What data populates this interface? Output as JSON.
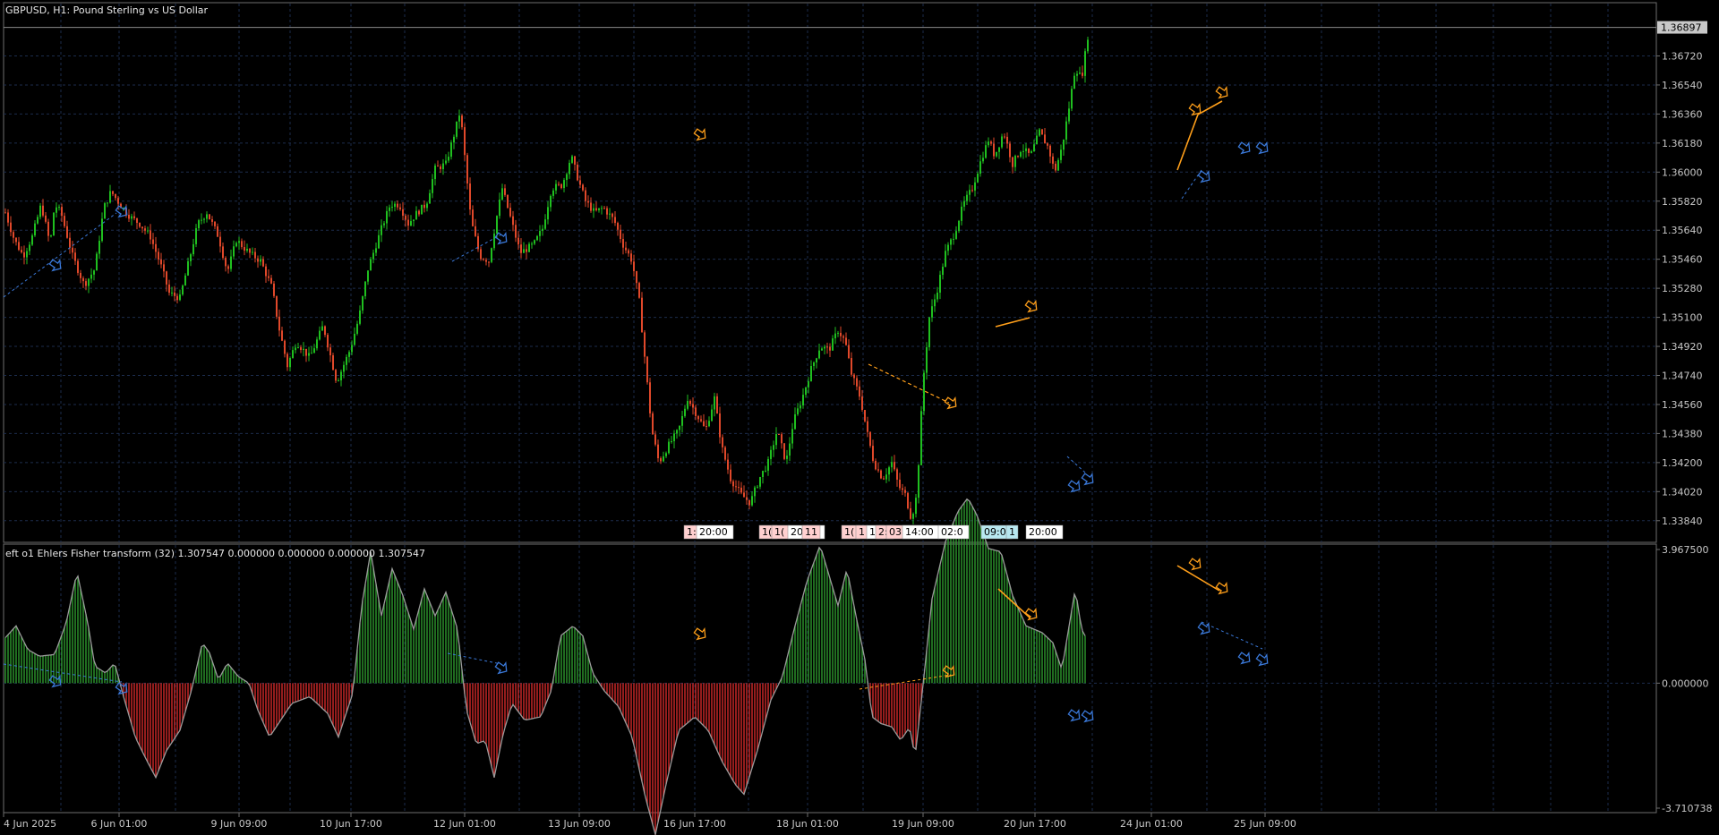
{
  "window": {
    "title": "GBPUSD, H1:  Pound Sterling vs US Dollar"
  },
  "indicator": {
    "title": "eft o1 Ehlers Fisher transform (32) 1.307547 0.000000 0.000000 0.000000 1.307547"
  },
  "colors": {
    "background": "#000000",
    "grid": "#1c2c4c",
    "bull_candle": "#1fbf1f",
    "bear_candle": "#e0482a",
    "histogram_up": "#2e9a2e",
    "histogram_down": "#d42a2a",
    "fisher_line": "#9a9a9a",
    "divergence_bearish": "#ff9f1a",
    "divergence_bullish": "#3a78d8",
    "axis_text": "#c8c8c8"
  },
  "icons": {
    "bearish_signal": "orange-arrow-icon",
    "bullish_signal": "blue-arrow-icon"
  },
  "chart_data": [
    {
      "type": "candlestick",
      "name": "GBPUSD H1 price",
      "current_price": "1.36897",
      "y_ticks": [
        "1.36720",
        "1.36540",
        "1.36360",
        "1.36180",
        "1.36000",
        "1.35820",
        "1.35640",
        "1.35460",
        "1.35280",
        "1.35100",
        "1.34920",
        "1.34740",
        "1.34560",
        "1.34380",
        "1.34200",
        "1.34020",
        "1.33840"
      ],
      "ylim": [
        1.3375,
        1.37
      ],
      "x_ticks": [
        "4 Jun 2025",
        "6 Jun 01:00",
        "9 Jun 09:00",
        "10 Jun 17:00",
        "12 Jun 01:00",
        "13 Jun 09:00",
        "16 Jun 17:00",
        "18 Jun 01:00",
        "19 Jun 09:00",
        "20 Jun 17:00",
        "24 Jun 01:00",
        "25 Jun 09:00"
      ],
      "close_path": [
        [
          0,
          1.3575
        ],
        [
          10,
          1.3558
        ],
        [
          20,
          1.3548
        ],
        [
          30,
          1.356
        ],
        [
          40,
          1.358
        ],
        [
          50,
          1.3555
        ],
        [
          55,
          1.358
        ],
        [
          62,
          1.3575
        ],
        [
          75,
          1.3548
        ],
        [
          88,
          1.353
        ],
        [
          100,
          1.354
        ],
        [
          110,
          1.3578
        ],
        [
          118,
          1.3588
        ],
        [
          128,
          1.358
        ],
        [
          140,
          1.3572
        ],
        [
          150,
          1.3568
        ],
        [
          162,
          1.356
        ],
        [
          175,
          1.354
        ],
        [
          183,
          1.3525
        ],
        [
          195,
          1.3522
        ],
        [
          205,
          1.3545
        ],
        [
          215,
          1.3568
        ],
        [
          225,
          1.3575
        ],
        [
          238,
          1.356
        ],
        [
          248,
          1.3538
        ],
        [
          258,
          1.3558
        ],
        [
          272,
          1.355
        ],
        [
          285,
          1.3545
        ],
        [
          298,
          1.3528
        ],
        [
          305,
          1.3505
        ],
        [
          315,
          1.348
        ],
        [
          325,
          1.3495
        ],
        [
          340,
          1.3485
        ],
        [
          355,
          1.3505
        ],
        [
          370,
          1.347
        ],
        [
          385,
          1.349
        ],
        [
          395,
          1.351
        ],
        [
          405,
          1.354
        ],
        [
          420,
          1.3565
        ],
        [
          430,
          1.358
        ],
        [
          440,
          1.358
        ],
        [
          450,
          1.3568
        ],
        [
          460,
          1.3575
        ],
        [
          470,
          1.358
        ],
        [
          480,
          1.3602
        ],
        [
          492,
          1.3605
        ],
        [
          502,
          1.3625
        ],
        [
          508,
          1.3638
        ],
        [
          520,
          1.357
        ],
        [
          530,
          1.3548
        ],
        [
          540,
          1.3545
        ],
        [
          548,
          1.357
        ],
        [
          555,
          1.359
        ],
        [
          565,
          1.357
        ],
        [
          575,
          1.355
        ],
        [
          590,
          1.3555
        ],
        [
          600,
          1.3565
        ],
        [
          610,
          1.359
        ],
        [
          622,
          1.3592
        ],
        [
          632,
          1.361
        ],
        [
          640,
          1.3595
        ],
        [
          648,
          1.3582
        ],
        [
          658,
          1.3575
        ],
        [
          668,
          1.3578
        ],
        [
          680,
          1.357
        ],
        [
          690,
          1.3555
        ],
        [
          700,
          1.3545
        ],
        [
          708,
          1.352
        ],
        [
          715,
          1.348
        ],
        [
          722,
          1.344
        ],
        [
          730,
          1.342
        ],
        [
          740,
          1.343
        ],
        [
          752,
          1.344
        ],
        [
          762,
          1.346
        ],
        [
          772,
          1.345
        ],
        [
          782,
          1.344
        ],
        [
          792,
          1.346
        ],
        [
          800,
          1.343
        ],
        [
          810,
          1.341
        ],
        [
          822,
          1.34
        ],
        [
          832,
          1.3395
        ],
        [
          842,
          1.341
        ],
        [
          852,
          1.342
        ],
        [
          862,
          1.344
        ],
        [
          872,
          1.342
        ],
        [
          880,
          1.3445
        ],
        [
          890,
          1.346
        ],
        [
          900,
          1.3478
        ],
        [
          910,
          1.3492
        ],
        [
          920,
          1.349
        ],
        [
          930,
          1.3502
        ],
        [
          938,
          1.3495
        ],
        [
          945,
          1.3475
        ],
        [
          955,
          1.346
        ],
        [
          962,
          1.344
        ],
        [
          970,
          1.342
        ],
        [
          980,
          1.341
        ],
        [
          990,
          1.342
        ],
        [
          998,
          1.3405
        ],
        [
          1005,
          1.34
        ],
        [
          1012,
          1.3385
        ],
        [
          1018,
          1.34
        ],
        [
          1025,
          1.347
        ],
        [
          1032,
          1.351
        ],
        [
          1040,
          1.3525
        ],
        [
          1050,
          1.355
        ],
        [
          1060,
          1.3562
        ],
        [
          1070,
          1.358
        ],
        [
          1080,
          1.359
        ],
        [
          1090,
          1.3608
        ],
        [
          1098,
          1.362
        ],
        [
          1105,
          1.361
        ],
        [
          1115,
          1.3625
        ],
        [
          1125,
          1.3605
        ],
        [
          1135,
          1.3615
        ],
        [
          1145,
          1.361
        ],
        [
          1155,
          1.3625
        ],
        [
          1165,
          1.3615
        ],
        [
          1172,
          1.36
        ],
        [
          1180,
          1.3615
        ],
        [
          1188,
          1.364
        ],
        [
          1195,
          1.3665
        ],
        [
          1202,
          1.3658
        ],
        [
          1210,
          1.3688
        ]
      ],
      "timestamp_markers": [
        "1:",
        "20:00",
        "1(",
        "1(",
        "20:00",
        "11",
        "1(",
        "1",
        "1(",
        "2:",
        "03:00",
        "14:00",
        "02:0",
        "09:0",
        "1",
        "20:00"
      ]
    },
    {
      "type": "histogram",
      "name": "eft o1 Ehlers Fisher transform (32)",
      "y_ticks": [
        "3.967500",
        "0.000000",
        "-3.710738"
      ],
      "ylim": [
        -3.710738,
        3.9675
      ],
      "fisher_path": [
        [
          0,
          1.35
        ],
        [
          12,
          1.7
        ],
        [
          25,
          1.0
        ],
        [
          38,
          0.8
        ],
        [
          55,
          0.85
        ],
        [
          68,
          1.8
        ],
        [
          80,
          3.3
        ],
        [
          92,
          1.8
        ],
        [
          100,
          0.5
        ],
        [
          112,
          0.3
        ],
        [
          122,
          0.6
        ],
        [
          132,
          -0.4
        ],
        [
          145,
          -1.6
        ],
        [
          158,
          -2.3
        ],
        [
          168,
          -2.8
        ],
        [
          180,
          -2.0
        ],
        [
          195,
          -1.4
        ],
        [
          208,
          -0.2
        ],
        [
          220,
          1.2
        ],
        [
          228,
          0.9
        ],
        [
          238,
          0.1
        ],
        [
          248,
          0.6
        ],
        [
          260,
          0.2
        ],
        [
          272,
          0.0
        ],
        [
          282,
          -0.8
        ],
        [
          295,
          -1.6
        ],
        [
          305,
          -1.2
        ],
        [
          320,
          -0.6
        ],
        [
          340,
          -0.4
        ],
        [
          360,
          -0.9
        ],
        [
          372,
          -1.6
        ],
        [
          388,
          -0.3
        ],
        [
          398,
          2.3
        ],
        [
          408,
          3.9
        ],
        [
          420,
          2.0
        ],
        [
          432,
          3.4
        ],
        [
          444,
          2.6
        ],
        [
          456,
          1.6
        ],
        [
          468,
          2.8
        ],
        [
          480,
          2.0
        ],
        [
          492,
          2.7
        ],
        [
          505,
          1.6
        ],
        [
          515,
          -0.8
        ],
        [
          526,
          -1.8
        ],
        [
          536,
          -1.7
        ],
        [
          546,
          -2.8
        ],
        [
          556,
          -1.5
        ],
        [
          566,
          -0.6
        ],
        [
          580,
          -1.1
        ],
        [
          598,
          -1.0
        ],
        [
          610,
          -0.2
        ],
        [
          620,
          1.4
        ],
        [
          634,
          1.7
        ],
        [
          645,
          1.4
        ],
        [
          656,
          0.3
        ],
        [
          668,
          -0.2
        ],
        [
          685,
          -0.7
        ],
        [
          700,
          -1.6
        ],
        [
          715,
          -3.4
        ],
        [
          726,
          -4.5
        ],
        [
          738,
          -3.0
        ],
        [
          752,
          -1.4
        ],
        [
          770,
          -1.0
        ],
        [
          785,
          -1.4
        ],
        [
          800,
          -2.3
        ],
        [
          815,
          -3.0
        ],
        [
          825,
          -3.3
        ],
        [
          840,
          -2.0
        ],
        [
          855,
          -0.5
        ],
        [
          868,
          0.2
        ],
        [
          880,
          1.5
        ],
        [
          895,
          3.0
        ],
        [
          910,
          4.1
        ],
        [
          920,
          3.2
        ],
        [
          930,
          2.3
        ],
        [
          940,
          3.4
        ],
        [
          950,
          2.0
        ],
        [
          960,
          0.7
        ],
        [
          968,
          -1.0
        ],
        [
          978,
          -1.2
        ],
        [
          990,
          -1.3
        ],
        [
          1000,
          -1.7
        ],
        [
          1010,
          -1.3
        ],
        [
          1016,
          -2.2
        ],
        [
          1024,
          -0.3
        ],
        [
          1035,
          2.5
        ],
        [
          1050,
          4.2
        ],
        [
          1064,
          5.1
        ],
        [
          1075,
          5.5
        ],
        [
          1085,
          5.0
        ],
        [
          1098,
          4.0
        ],
        [
          1112,
          3.9
        ],
        [
          1125,
          2.6
        ],
        [
          1140,
          1.7
        ],
        [
          1158,
          1.5
        ],
        [
          1170,
          1.2
        ],
        [
          1180,
          0.4
        ],
        [
          1195,
          2.8
        ],
        [
          1202,
          1.6
        ],
        [
          1208,
          1.31
        ]
      ]
    }
  ]
}
